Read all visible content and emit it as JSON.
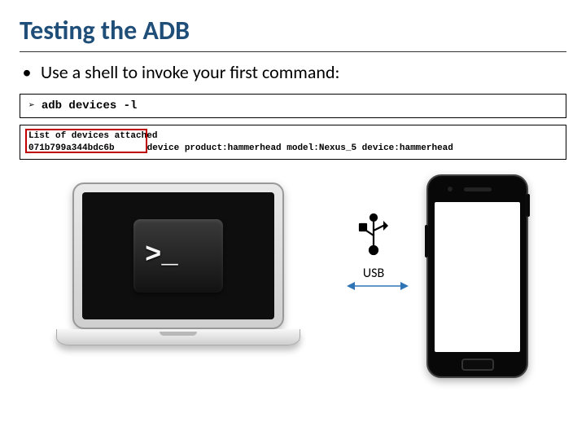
{
  "slide": {
    "title": "Testing the ADB",
    "bullet": "Use a shell to invoke your first command:",
    "command": {
      "prompt_glyph": "➢",
      "text": "adb devices -l"
    },
    "output": {
      "header": "List of devices attached",
      "device": {
        "serial": "071b799a344bdc6b",
        "details": "device product:hammerhead model:Nexus_5 device:hammerhead"
      }
    },
    "diagram": {
      "terminal_glyph": ">_",
      "connection_label": "USB"
    }
  }
}
